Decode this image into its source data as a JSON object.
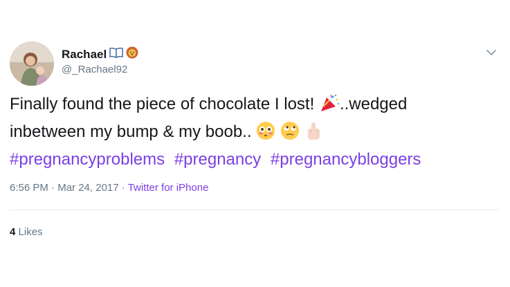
{
  "tweet": {
    "author": {
      "name": "Rachael",
      "handle": "@_Rachael92",
      "name_icons": [
        "open-book-icon",
        "lion-face-icon"
      ]
    },
    "text": {
      "line1_a": "Finally found the piece of chocolate I lost!",
      "line1_b": "..wedged",
      "line2": "inbetween my bump & my boob..",
      "emojis": [
        "party-popper-icon",
        "flushed-face-icon",
        "eye-roll-face-icon",
        "middle-finger-icon"
      ],
      "hashtags": [
        "#pregnancyproblems",
        "#pregnancy",
        "#pregnancybloggers"
      ]
    },
    "meta": {
      "time": "6:56 PM",
      "separator": "·",
      "date": "Mar 24, 2017",
      "source": "Twitter for iPhone"
    },
    "stats": {
      "likes_count": "4",
      "likes_label": "Likes"
    },
    "colors": {
      "hashtag": "#7b3fe4",
      "secondary_text": "#657786",
      "primary_text": "#14171a",
      "divider": "#e6ecf0"
    }
  }
}
